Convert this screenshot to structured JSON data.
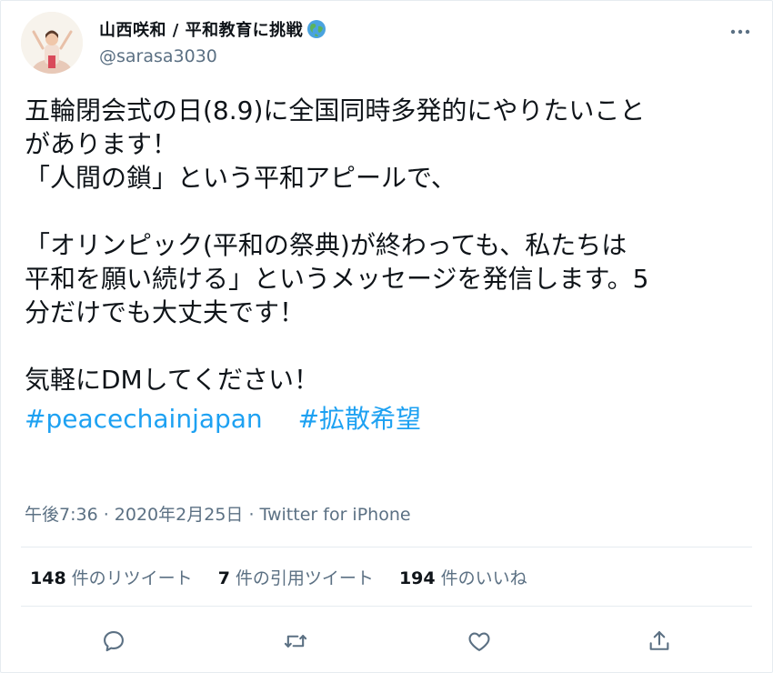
{
  "tweet": {
    "author": {
      "display_name": "山西咲和 / 平和教育に挑戦",
      "handle": "@sarasa3030",
      "avatar_icon": "profile-photo",
      "name_emoji_icon": "globe-icon"
    },
    "body_lines": [
      "五輪閉会式の日(8.9)に全国同時多発的にやりたいこと",
      "があります！",
      "「人間の鎖」という平和アピールで、",
      "",
      "「オリンピック(平和の祭典)が終わっても、私たちは",
      "平和を願い続ける」というメッセージを発信します。5",
      "分だけでも大丈夫です！",
      "",
      "気軽にDMしてください！"
    ],
    "hashtags": [
      "#peacechainjapan",
      "#拡散希望"
    ],
    "timestamp": "午後7:36 · 2020年2月25日",
    "separator": " · ",
    "source": "Twitter for iPhone",
    "stats": {
      "retweets_count": "148",
      "retweets_label": "件のリツイート",
      "quotes_count": "7",
      "quotes_label": "件の引用ツイート",
      "likes_count": "194",
      "likes_label": "件のいいね"
    },
    "actions": [
      "reply-icon",
      "retweet-icon",
      "like-icon",
      "share-icon"
    ],
    "accent_color": "#1da1f2",
    "secondary_text_color": "#5b7083"
  }
}
